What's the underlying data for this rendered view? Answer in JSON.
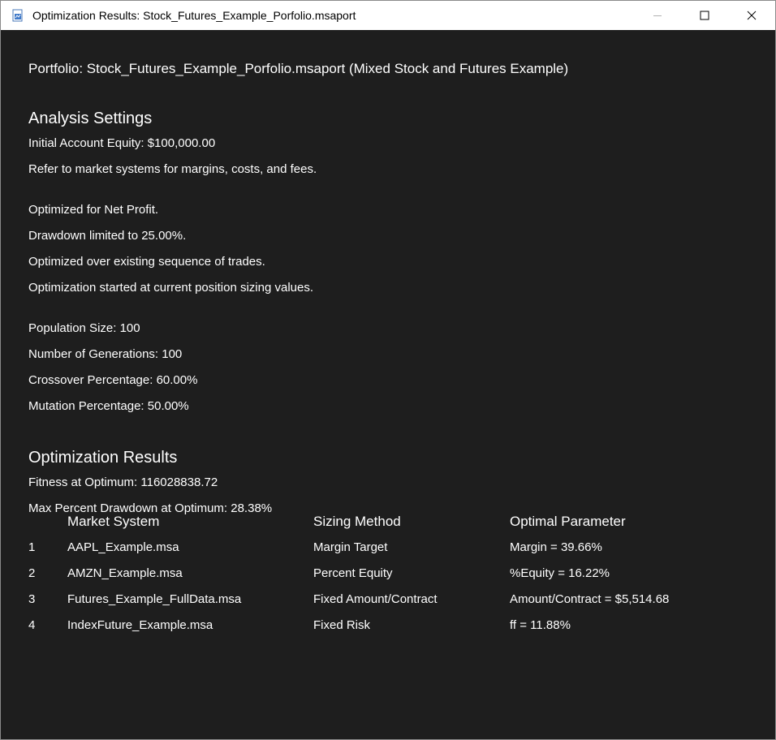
{
  "window": {
    "title": "Optimization Results: Stock_Futures_Example_Porfolio.msaport",
    "icon": "document-chart-icon",
    "buttons": [
      "minimize",
      "maximize",
      "close"
    ]
  },
  "portfolio_line": "Portfolio: Stock_Futures_Example_Porfolio.msaport (Mixed Stock and Futures Example)",
  "analysis_settings": {
    "heading": "Analysis Settings",
    "equity": "Initial Account Equity: $100,000.00",
    "margins_note": "Refer to market systems for margins, costs, and fees.",
    "optimized_for": "Optimized for Net Profit.",
    "drawdown_limit": "Drawdown limited to 25.00%.",
    "sequence": "Optimized over existing sequence of trades.",
    "start_values": "Optimization started at current position sizing values.",
    "population": "Population Size: 100",
    "generations": "Number of Generations: 100",
    "crossover": "Crossover Percentage: 60.00%",
    "mutation": "Mutation Percentage: 50.00%"
  },
  "results": {
    "heading": "Optimization Results",
    "fitness": "Fitness at Optimum: 116028838.72",
    "max_drawdown": "Max Percent Drawdown at Optimum: 28.38%",
    "columns": {
      "num": "",
      "market_system": "Market System",
      "sizing_method": "Sizing Method",
      "optimal_parameter": "Optimal Parameter"
    },
    "rows": [
      {
        "num": "1",
        "market_system": "AAPL_Example.msa",
        "sizing_method": "Margin Target",
        "optimal_parameter": "Margin = 39.66%"
      },
      {
        "num": "2",
        "market_system": "AMZN_Example.msa",
        "sizing_method": "Percent Equity",
        "optimal_parameter": "%Equity = 16.22%"
      },
      {
        "num": "3",
        "market_system": "Futures_Example_FullData.msa",
        "sizing_method": "Fixed Amount/Contract",
        "optimal_parameter": "Amount/Contract = $5,514.68"
      },
      {
        "num": "4",
        "market_system": "IndexFuture_Example.msa",
        "sizing_method": "Fixed Risk",
        "optimal_parameter": "ff = 11.88%"
      }
    ]
  },
  "colors": {
    "background": "#1e1e1e",
    "text": "#ffffff",
    "titlebar": "#ffffff"
  }
}
